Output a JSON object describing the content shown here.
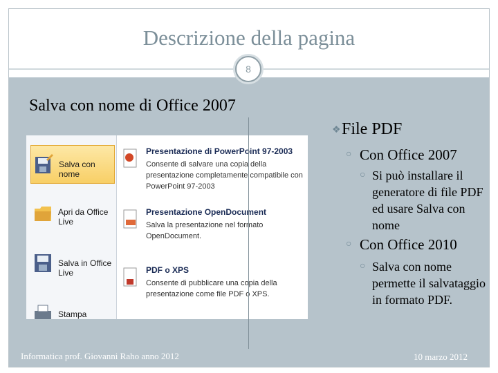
{
  "slide": {
    "title": "Descrizione della pagina",
    "page_number": "8",
    "subtitle": "Salva con nome di Office 2007"
  },
  "bullets": {
    "level1": "File PDF",
    "group1": {
      "label": "Con Office 2007",
      "text": "Si può installare il generatore di file PDF ed usare Salva con nome"
    },
    "group2": {
      "label": "Con Office 2010",
      "text": "Salva con nome permette il salvataggio  in formato PDF."
    }
  },
  "footer": {
    "left": "Informatica prof. Giovanni Raho anno 2012",
    "right": "10 marzo 2012"
  },
  "screenshot": {
    "menu_items": [
      {
        "label": "Salva con nome",
        "selected": true
      },
      {
        "label": "Apri da Office Live",
        "selected": false
      },
      {
        "label": "Salva in Office Live",
        "selected": false
      },
      {
        "label": "Stampa",
        "selected": false
      }
    ],
    "options": [
      {
        "title": "Presentazione di PowerPoint 97-2003",
        "desc": "Consente di salvare una copia della presentazione completamente compatibile con PowerPoint 97-2003"
      },
      {
        "title": "Presentazione OpenDocument",
        "desc": "Salva la presentazione nel formato OpenDocument."
      },
      {
        "title": "PDF o XPS",
        "desc": "Consente di pubblicare una copia della presentazione come file PDF o XPS."
      }
    ],
    "header_partial": "Presentazione di PowerPoint 97-2003"
  },
  "colors": {
    "title": "#7c8f99",
    "body_bg": "#b6c3cb",
    "bullet": "#6f8794",
    "selected_item": "#f8cf66"
  }
}
